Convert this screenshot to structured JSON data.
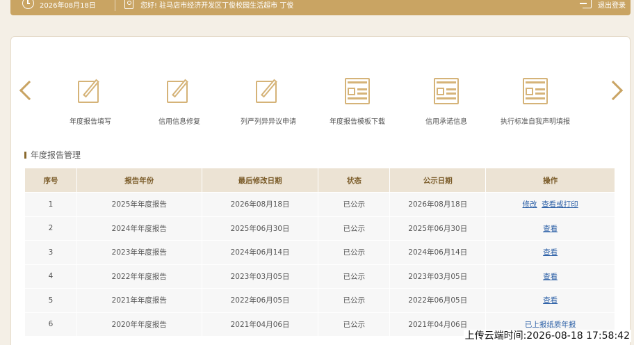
{
  "header": {
    "date": "2026年08月18日",
    "greeting": "您好!  驻马店市经济开发区丁俊校园生活超市    丁俊",
    "logout_label": "退出登录",
    "accent_color": "#c9a463"
  },
  "quick_links": [
    {
      "label": "年度报告填写",
      "icon": "edit-document-icon"
    },
    {
      "label": "信用信息修复",
      "icon": "edit-document-icon"
    },
    {
      "label": "列严列异异议申请",
      "icon": "edit-document-icon"
    },
    {
      "label": "年度报告模板下载",
      "icon": "form-document-icon"
    },
    {
      "label": "信用承诺信息",
      "icon": "form-document-icon"
    },
    {
      "label": "执行标准自我声明填报",
      "icon": "form-document-icon"
    }
  ],
  "section": {
    "title": "年度报告管理"
  },
  "table": {
    "headers": [
      "序号",
      "报告年份",
      "最后修改日期",
      "状态",
      "公示日期",
      "操作"
    ],
    "rows": [
      {
        "no": "1",
        "year": "2025年年度报告",
        "modified": "2026年08月18日",
        "status": "已公示",
        "published": "2026年08月18日",
        "action1": "修改",
        "action2": "查看或打印"
      },
      {
        "no": "2",
        "year": "2024年年度报告",
        "modified": "2025年06月30日",
        "status": "已公示",
        "published": "2025年06月30日",
        "action1": "查看"
      },
      {
        "no": "3",
        "year": "2023年年度报告",
        "modified": "2024年06月14日",
        "status": "已公示",
        "published": "2024年06月14日",
        "action1": "查看"
      },
      {
        "no": "4",
        "year": "2022年年度报告",
        "modified": "2023年03月05日",
        "status": "已公示",
        "published": "2023年03月05日",
        "action1": "查看"
      },
      {
        "no": "5",
        "year": "2021年年度报告",
        "modified": "2022年06月05日",
        "status": "已公示",
        "published": "2022年06月05日",
        "action1": "查看"
      },
      {
        "no": "6",
        "year": "2020年年度报告",
        "modified": "2021年04月06日",
        "status": "已公示",
        "published": "2021年04月06日",
        "action_text": "已上报纸质年报"
      }
    ]
  },
  "watermark": "上传云端时间:2026-08-18 17:58:42"
}
